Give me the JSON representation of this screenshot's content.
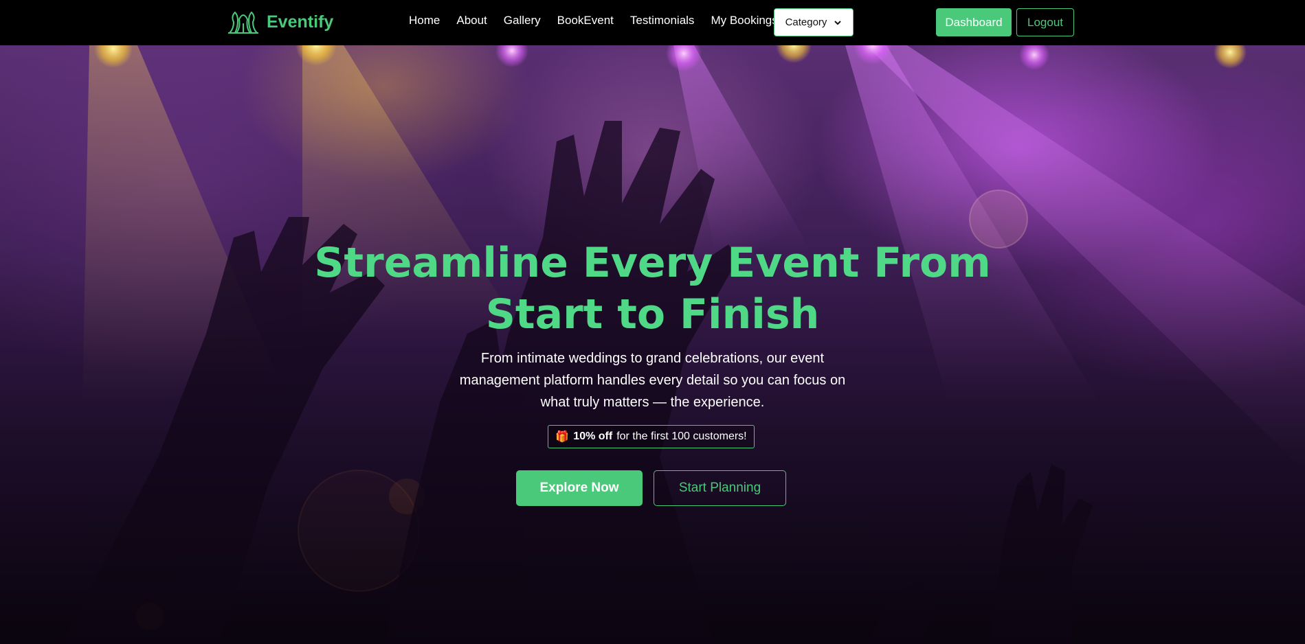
{
  "brand": {
    "name": "Eventify",
    "logo_icon": "tent-icon",
    "color": "#4bc97a"
  },
  "nav": {
    "links": [
      "Home",
      "About",
      "Gallery",
      "BookEvent",
      "Testimonials",
      "My Bookings"
    ],
    "category_label": "Category",
    "dashboard_label": "Dashboard",
    "logout_label": "Logout"
  },
  "hero": {
    "headline_line1": "Streamline Every Event From",
    "headline_line2": "Start to Finish",
    "subtext": "From intimate weddings to grand celebrations, our event management platform handles every detail so you can focus on what truly matters — the experience.",
    "promo_icon": "gift-icon",
    "promo_bold": "10% off",
    "promo_rest": "for the first 100 customers!",
    "explore_label": "Explore Now",
    "plan_label": "Start Planning"
  },
  "colors": {
    "accent": "#4bc97a",
    "headline": "#4fd886",
    "navbar_bg": "#000000"
  }
}
